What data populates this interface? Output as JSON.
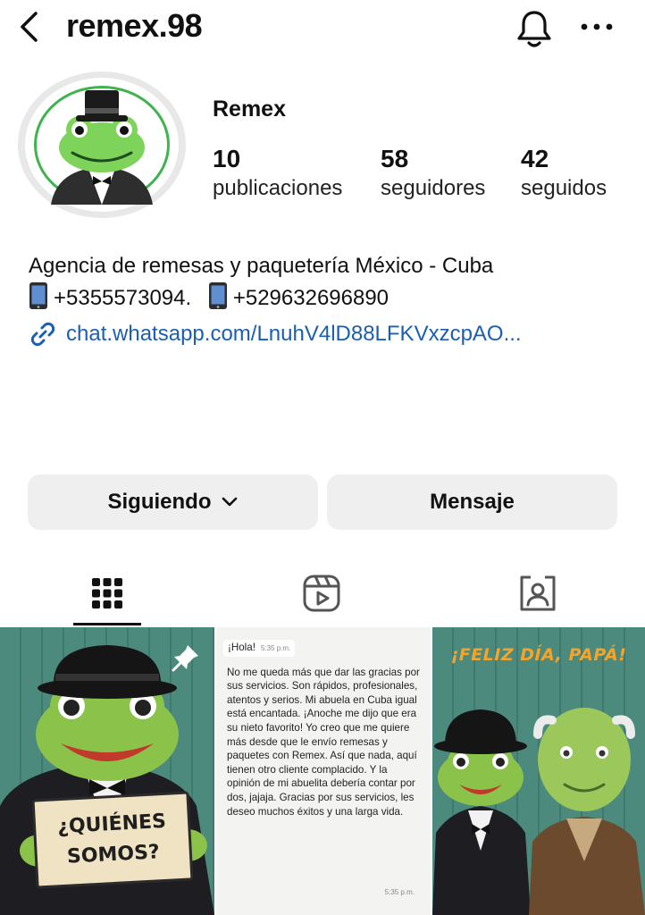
{
  "header": {
    "username": "remex.98",
    "back_icon": "chevron-left-icon",
    "bell_icon": "bell-icon",
    "more_icon": "more-horizontal-icon"
  },
  "profile": {
    "display_name": "Remex",
    "stats": [
      {
        "value": "10",
        "label": "publicaciones"
      },
      {
        "value": "58",
        "label": "seguidores"
      },
      {
        "value": "42",
        "label": "seguidos"
      }
    ],
    "bio_line1": "Agencia de remesas y paquetería México - Cuba",
    "phone1": "+5355573094.",
    "phone2": "+529632696890",
    "link": "chat.whatsapp.com/LnuhV4lD88LFKVxzcpAO..."
  },
  "actions": {
    "following_label": "Siguiendo",
    "message_label": "Mensaje"
  },
  "tabs": [
    {
      "name": "posts",
      "icon": "grid-icon",
      "active": true
    },
    {
      "name": "reels",
      "icon": "reels-icon",
      "active": false
    },
    {
      "name": "tagged",
      "icon": "tagged-person-icon",
      "active": false
    }
  ],
  "posts": {
    "post1": {
      "sign_line1": "¿QUIÉNES",
      "sign_line2": "SOMOS?"
    },
    "post2": {
      "greeting": "¡Hola!",
      "time_start": "5:35 p.m.",
      "message": "No me queda más que dar las gracias por sus servicios. Son rápidos, profesionales, atentos y serios. Mi abuela en Cuba igual está encantada. ¡Anoche me dijo que era su nieto favorito! Yo creo que me quiere más desde que le envío remesas y paquetes con Remex. Así que nada, aquí tienen otro cliente complacido. Y la opinión de mi abuelita debería contar por dos, jajaja. Gracias por sus servicios, les deseo muchos éxitos y una larga vida.",
      "time_end": "5:35 p.m."
    },
    "post3": {
      "headline": "¡FELIZ DÍA, PAPÁ!"
    }
  },
  "colors": {
    "link": "#1a5fb4",
    "button_bg": "#efefef",
    "avatar_ring": "#3fb34f",
    "post_bg": "#4f8f83",
    "headline": "#f4a42b"
  }
}
